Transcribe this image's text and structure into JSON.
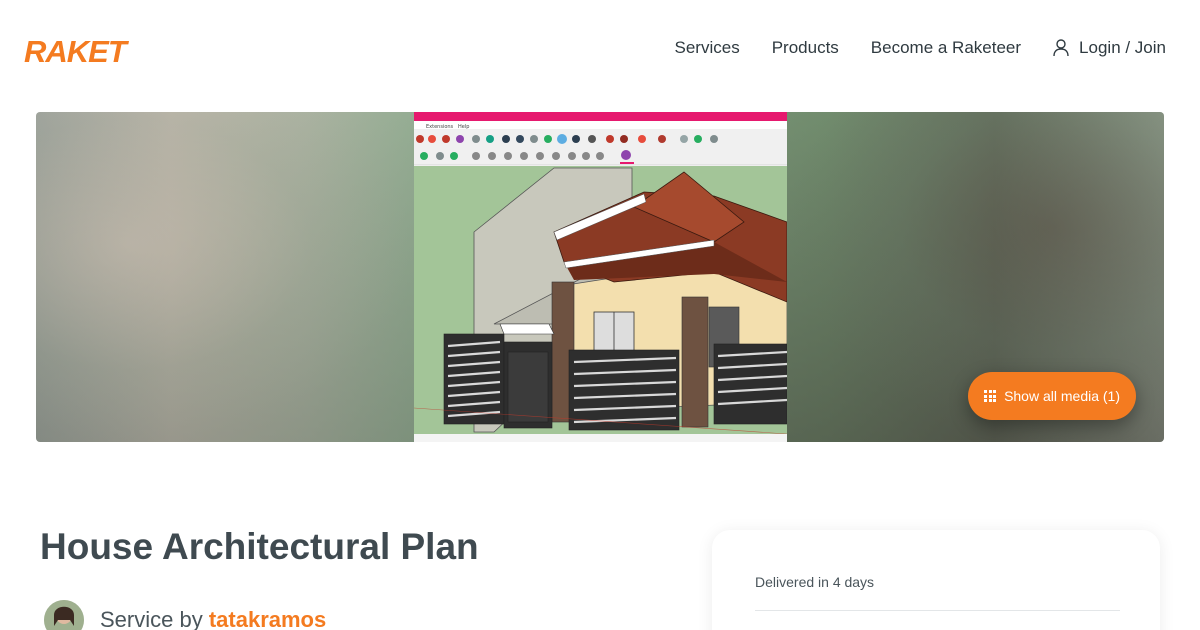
{
  "header": {
    "logo_text": "RAKET",
    "nav": {
      "services": "Services",
      "products": "Products",
      "become": "Become a Raketeer",
      "login": "Login / Join"
    }
  },
  "hero": {
    "show_media_label": "Show all media (1)",
    "screenshot_menu": [
      "Extensions",
      "Help"
    ]
  },
  "listing": {
    "title": "House Architectural Plan",
    "service_prefix": "Service by",
    "seller": "tatakramos",
    "delivered": "Delivered in 4 days"
  },
  "colors": {
    "brand": "#f47b20",
    "text": "#2f3a40"
  }
}
